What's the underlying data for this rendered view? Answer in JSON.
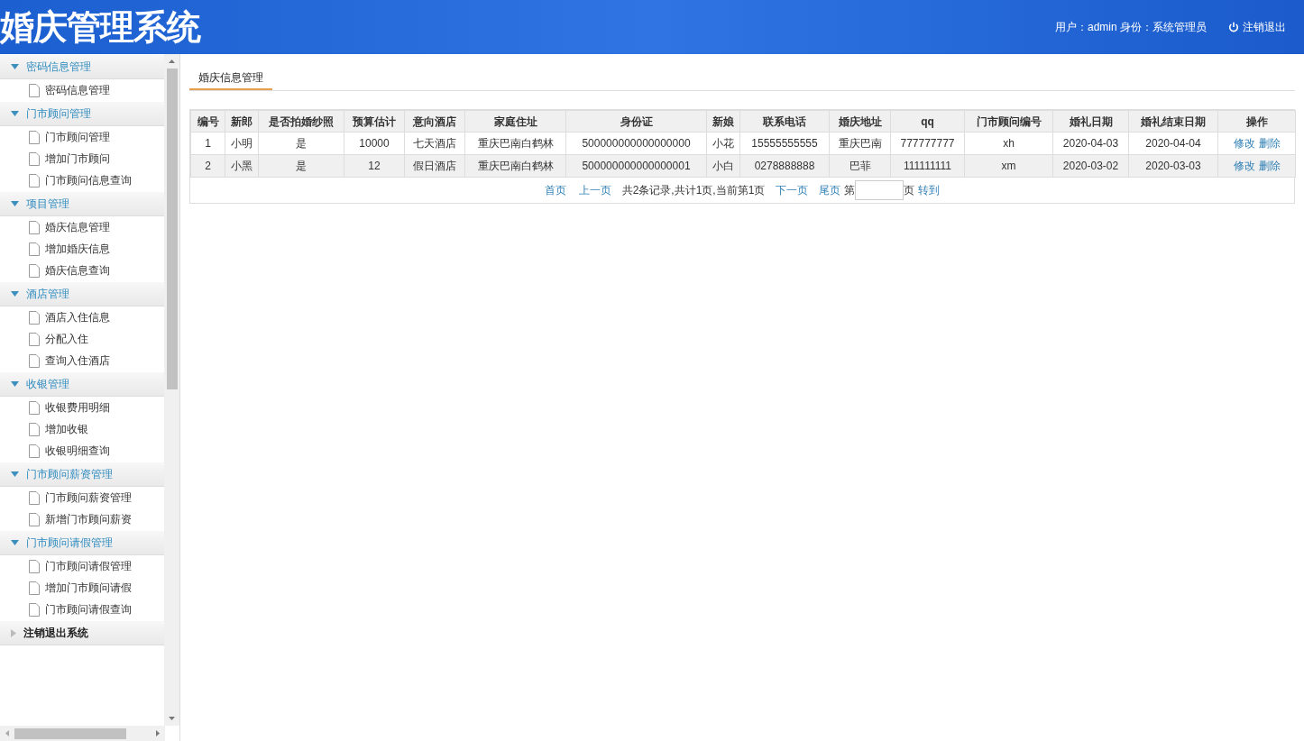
{
  "header": {
    "title": "婚庆管理系统",
    "user_info": "用户：admin 身份：系统管理员",
    "logout": "注销退出"
  },
  "sidebar": {
    "groups": [
      {
        "label": "密码信息管理",
        "expanded": true,
        "items": [
          "密码信息管理"
        ]
      },
      {
        "label": "门市顾问管理",
        "expanded": true,
        "items": [
          "门市顾问管理",
          "增加门市顾问",
          "门市顾问信息查询"
        ]
      },
      {
        "label": "项目管理",
        "expanded": true,
        "items": [
          "婚庆信息管理",
          "增加婚庆信息",
          "婚庆信息查询"
        ]
      },
      {
        "label": "酒店管理",
        "expanded": true,
        "items": [
          "酒店入住信息",
          "分配入住",
          "查询入住酒店"
        ]
      },
      {
        "label": "收银管理",
        "expanded": true,
        "items": [
          "收银费用明细",
          "增加收银",
          "收银明细查询"
        ]
      },
      {
        "label": "门市顾问薪资管理",
        "expanded": true,
        "items": [
          "门市顾问薪资管理",
          "新增门市顾问薪资"
        ]
      },
      {
        "label": "门市顾问请假管理",
        "expanded": true,
        "items": [
          "门市顾问请假管理",
          "增加门市顾问请假",
          "门市顾问请假查询"
        ]
      },
      {
        "label": "注销退出系统",
        "expanded": false
      }
    ]
  },
  "tabs": [
    {
      "label": "婚庆信息管理",
      "selected": true
    }
  ],
  "table": {
    "columns": [
      "编号",
      "新郎",
      "是否拍婚纱照",
      "预算估计",
      "意向酒店",
      "家庭住址",
      "身份证",
      "新娘",
      "联系电话",
      "婚庆地址",
      "qq",
      "门市顾问编号",
      "婚礼日期",
      "婚礼结束日期",
      "操作"
    ],
    "rows": [
      {
        "cells": [
          "1",
          "小明",
          "是",
          "10000",
          "七天酒店",
          "重庆巴南白鹤林",
          "500000000000000000",
          "小花",
          "15555555555",
          "重庆巴南",
          "777777777",
          "xh",
          "2020-04-03",
          "2020-04-04"
        ],
        "actions": [
          "修改",
          "删除"
        ]
      },
      {
        "cells": [
          "2",
          "小黑",
          "是",
          "12",
          "假日酒店",
          "重庆巴南白鹤林",
          "500000000000000001",
          "小白",
          "0278888888",
          "巴菲",
          "111111111",
          "xm",
          "2020-03-02",
          "2020-03-03"
        ],
        "actions": [
          "修改",
          "删除"
        ]
      }
    ]
  },
  "pagination": {
    "first": "首页",
    "prev": "上一页",
    "summary": "共2条记录,共计1页,当前第1页",
    "next": "下一页",
    "last": "尾页",
    "page_prefix": "第",
    "page_suffix": "页",
    "go": "转到"
  }
}
